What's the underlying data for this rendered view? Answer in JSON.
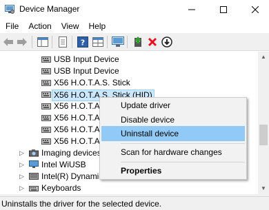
{
  "window": {
    "title": "Device Manager",
    "controls": {
      "minimize": "—",
      "maximize": "☐",
      "close": "✕"
    }
  },
  "menu": [
    "File",
    "Action",
    "View",
    "Help"
  ],
  "toolbar": {
    "icons": [
      "back-icon",
      "forward-icon",
      "show-hide-tree-icon",
      "properties-icon",
      "help-icon",
      "update-driver-icon",
      "scan-hardware-icon",
      "add-legacy-icon",
      "uninstall-icon",
      "disable-icon"
    ]
  },
  "tree": {
    "items": [
      {
        "label": "USB Input Device",
        "type": "device"
      },
      {
        "label": "USB Input Device",
        "type": "device"
      },
      {
        "label": "X56 H.O.T.A.S. Stick",
        "type": "device"
      },
      {
        "label": "X56 H.O.T.A.S. Stick (HID)",
        "type": "device",
        "selected": true
      },
      {
        "label": "X56 H.O.T.A.S. Stick",
        "type": "device"
      },
      {
        "label": "X56 H.O.T.A.S. Stick",
        "type": "device"
      },
      {
        "label": "X56 H.O.T.A.S. Stick",
        "type": "device"
      },
      {
        "label": "X56 H.O.T.A.S. Stick",
        "type": "device"
      },
      {
        "label": "Imaging devices",
        "type": "category"
      },
      {
        "label": "Intel WiUSB",
        "type": "category"
      },
      {
        "label": "Intel(R) Dynamic Platform and Thermal Framework",
        "type": "category"
      },
      {
        "label": "Keyboards",
        "type": "category"
      }
    ]
  },
  "context_menu": {
    "items": [
      {
        "label": "Update driver"
      },
      {
        "label": "Disable device"
      },
      {
        "label": "Uninstall device",
        "highlighted": true
      },
      {
        "label": "Scan for hardware changes"
      },
      {
        "label": "Properties",
        "bold": true
      }
    ]
  },
  "status": {
    "text": "Uninstalls the driver for the selected device."
  },
  "colors": {
    "selection": "#cce8ff",
    "menu_highlight": "#91c9f7",
    "uninstall_red": "#e81123",
    "update_green": "#2e9e2e"
  }
}
